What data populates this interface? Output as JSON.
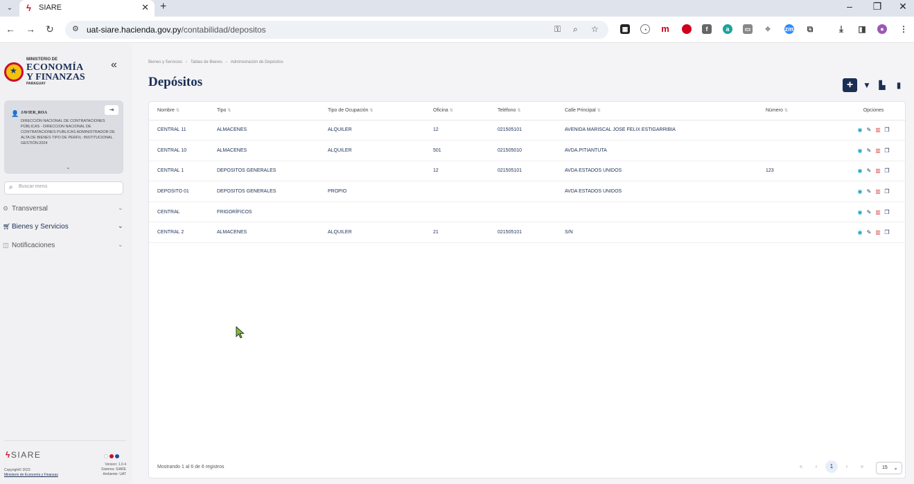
{
  "browser": {
    "tab_title": "SIARE",
    "url_host": "uat-siare.hacienda.gov.py",
    "url_path": "/contabilidad/depositos"
  },
  "sidebar": {
    "logo": {
      "line1": "MINISTERIO DE",
      "line2": "ECONOMÍA",
      "line3": "Y FINANZAS",
      "line4": "PARAGUAY"
    },
    "user": {
      "name": "JAVIER_ROA",
      "detail": "DIRECCIÓN NACIONAL DE CONTRATACIONES PÚBLICAS - DIRECCION NACIONAL DE CONTRATACIONES PUBLICAS ADMINISTRADOR DE ALTA DE BIENES TIPO DE PERFIL: INSTITUCIONAL GESTIÓN:2024"
    },
    "search_placeholder": "Buscar menú",
    "menu": [
      {
        "label": "Transversal"
      },
      {
        "label": "Bienes y Servicios"
      },
      {
        "label": "Notificaciones"
      }
    ],
    "brand": "SIARE",
    "footer": {
      "copyright": "Copyright© 2023",
      "ministry": "Ministerio de Economía y Finanzas",
      "version": "Version: 1.0.4",
      "system": "Sistema: SIARE",
      "environment": "Ambiente: UAT"
    }
  },
  "breadcrumb": [
    "Bienes y Servicios",
    "Tablas de Bienes",
    "Administración de Depósitos"
  ],
  "page_title": "Depósitos",
  "table": {
    "columns": [
      "Nombre",
      "Tipo",
      "Tipo de Ocupación",
      "Oficina",
      "Teléfono",
      "Calle Principal",
      "Número",
      "Opciones"
    ],
    "rows": [
      [
        "CENTRAL 11",
        "ALMACENES",
        "ALQUILER",
        "12",
        "021505101",
        "AVENIDA MARISCAL JOSE FELIX ESTIGARRIBIA",
        ""
      ],
      [
        "CENTRAL 10",
        "ALMACENES",
        "ALQUILER",
        "501",
        "021505010",
        "AVDA.PITIANTUTA",
        ""
      ],
      [
        "CENTRAL 1",
        "DEPOSITOS GENERALES",
        "",
        "12",
        "021505101",
        "AVDA ESTADOS UNIDOS",
        "123"
      ],
      [
        "DEPOSITO 01",
        "DEPOSITOS GENERALES",
        "PROPIO",
        "",
        "",
        "AVDA ESTADOS UNIDOS",
        ""
      ],
      [
        "CENTRAL",
        "FRIGORÍFICOS",
        "",
        "",
        "",
        "",
        ""
      ],
      [
        "CENTRAL 2",
        "ALMACENES",
        "ALQUILER",
        "21",
        "021505101",
        "S/N",
        ""
      ]
    ]
  },
  "footer": {
    "showing": "Mostrando 1 al 6 de 6 registros",
    "current_page": "1",
    "rows_per_page": "15"
  }
}
